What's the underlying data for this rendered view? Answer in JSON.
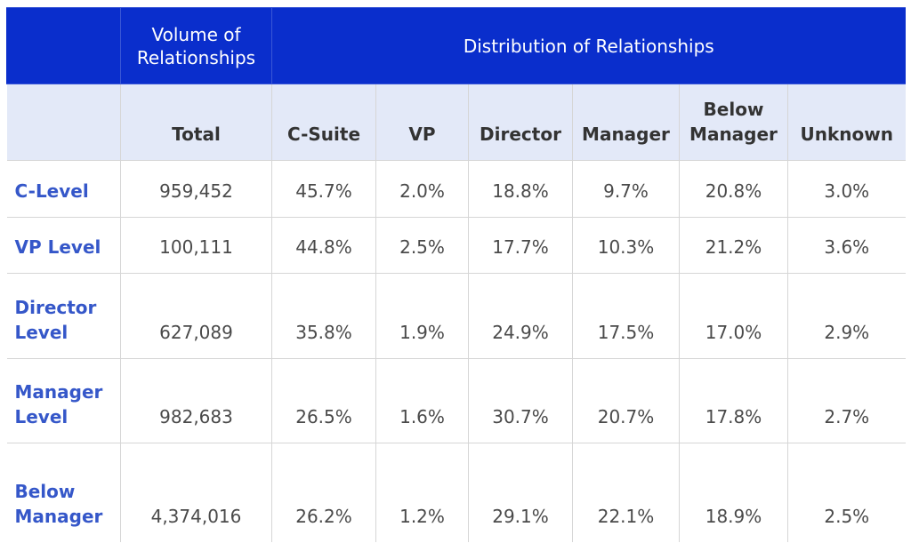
{
  "header": {
    "volume_label": "Volume of Relationships",
    "distribution_label": "Distribution of Relationships"
  },
  "columns": [
    "",
    "Total",
    "C-Suite",
    "VP",
    "Director",
    "Manager",
    "Below Manager",
    "Unknown"
  ],
  "rows": [
    {
      "label": "C-Level",
      "total": "959,452",
      "values": [
        "45.7%",
        "2.0%",
        "18.8%",
        "9.7%",
        "20.8%",
        "3.0%"
      ]
    },
    {
      "label": "VP Level",
      "total": "100,111",
      "values": [
        "44.8%",
        "2.5%",
        "17.7%",
        "10.3%",
        "21.2%",
        "3.6%"
      ]
    },
    {
      "label": "Director Level",
      "total": "627,089",
      "values": [
        "35.8%",
        "1.9%",
        "24.9%",
        "17.5%",
        "17.0%",
        "2.9%"
      ]
    },
    {
      "label": "Manager Level",
      "total": "982,683",
      "values": [
        "26.5%",
        "1.6%",
        "30.7%",
        "20.7%",
        "17.8%",
        "2.7%"
      ]
    },
    {
      "label": "Below Manager",
      "total": "4,374,016",
      "values": [
        "26.2%",
        "1.2%",
        "29.1%",
        "22.1%",
        "18.9%",
        "2.5%"
      ]
    }
  ],
  "colors": {
    "header_bg": "#0a2ecc",
    "subheader_bg": "#e3e9f8",
    "row_label": "#3557c9"
  }
}
